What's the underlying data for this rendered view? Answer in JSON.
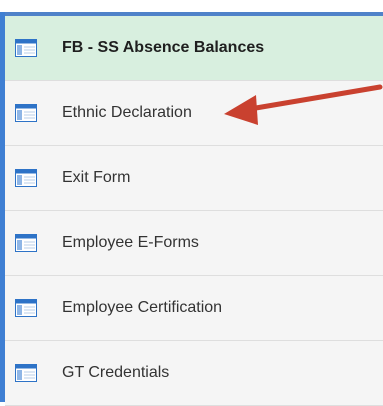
{
  "menu": {
    "items": [
      {
        "label": "FB - SS Absence Balances",
        "icon": "page-icon",
        "selected": true
      },
      {
        "label": "Ethnic Declaration",
        "icon": "page-icon",
        "selected": false
      },
      {
        "label": "Exit Form",
        "icon": "page-icon",
        "selected": false
      },
      {
        "label": "Employee E-Forms",
        "icon": "page-icon",
        "selected": false
      },
      {
        "label": "Employee Certification",
        "icon": "page-icon",
        "selected": false
      },
      {
        "label": "GT Credentials",
        "icon": "page-icon",
        "selected": false
      }
    ]
  },
  "annotation": {
    "arrow_color": "#c9412f",
    "points_to": "Ethnic Declaration"
  },
  "colors": {
    "selected_background": "#d8efdf",
    "item_background": "#f5f5f5",
    "accent_blue": "#3f7fd3",
    "icon_blue": "#2e73c7"
  }
}
